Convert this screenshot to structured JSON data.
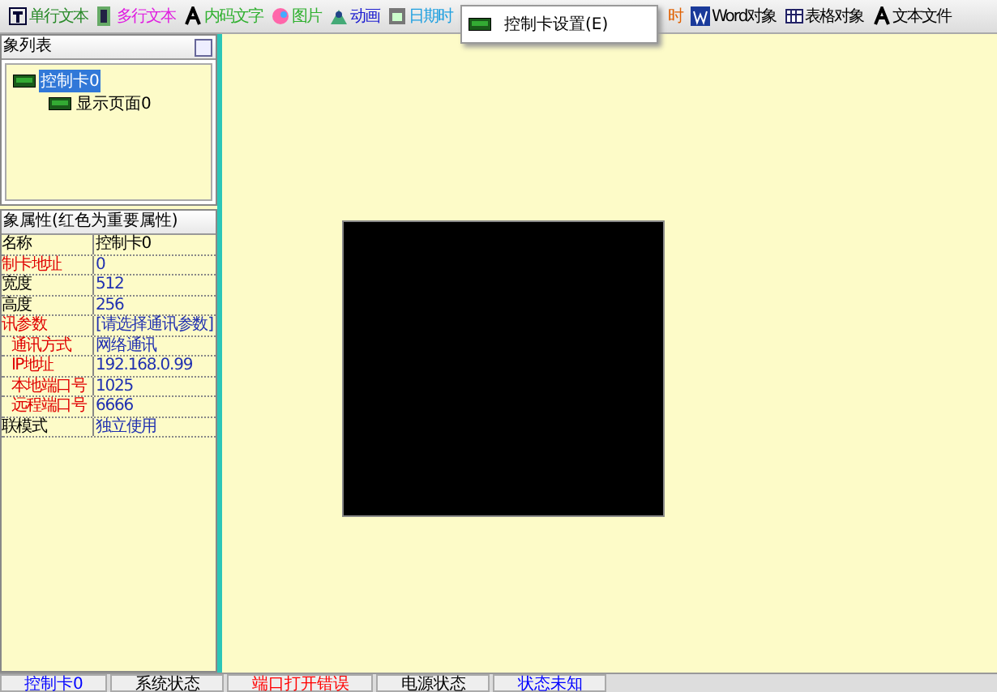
{
  "toolbar": [
    {
      "label": "单行文本"
    },
    {
      "label": "多行文本"
    },
    {
      "label": "内码文字"
    },
    {
      "label": "图片"
    },
    {
      "label": "动画"
    },
    {
      "label": "日期时"
    },
    {
      "label": "时"
    },
    {
      "label": "Word对象"
    },
    {
      "label": "表格对象"
    },
    {
      "label": "文本文件"
    }
  ],
  "menu": {
    "items": [
      "控制卡设置(E)"
    ]
  },
  "object_list": {
    "title": "象列表",
    "tree": [
      {
        "label": "控制卡0",
        "selected": true,
        "children": [
          {
            "label": "显示页面0",
            "selected": false
          }
        ]
      }
    ]
  },
  "properties": {
    "title": "象属性(红色为重要属性)",
    "rows": [
      {
        "name": "名称",
        "value": "控制卡0",
        "important": false,
        "kind": "main"
      },
      {
        "name": "制卡地址",
        "value": "0",
        "important": true,
        "kind": "main"
      },
      {
        "name": "宽度",
        "value": "512",
        "important": false,
        "kind": "main"
      },
      {
        "name": "高度",
        "value": "256",
        "important": false,
        "kind": "main"
      },
      {
        "name": "讯参数",
        "value": "[请选择通讯参数]",
        "important": true,
        "kind": "main"
      },
      {
        "name": "通讯方式",
        "value": "网络通讯",
        "important": true,
        "kind": "sub"
      },
      {
        "name": "IP地址",
        "value": "192.168.0.99",
        "important": true,
        "kind": "sub"
      },
      {
        "name": "本地端口号",
        "value": "1025",
        "important": true,
        "kind": "sub"
      },
      {
        "name": "远程端口号",
        "value": "6666",
        "important": true,
        "kind": "sub"
      },
      {
        "name": "联模式",
        "value": "独立使用",
        "important": false,
        "kind": "main"
      }
    ]
  },
  "status_bar": [
    {
      "text": "控制卡0",
      "kind": "value"
    },
    {
      "text": "系统状态",
      "kind": "label"
    },
    {
      "text": "端口打开错误",
      "kind": "error"
    },
    {
      "text": "电源状态",
      "kind": "label"
    },
    {
      "text": "状态未知",
      "kind": "value"
    }
  ]
}
